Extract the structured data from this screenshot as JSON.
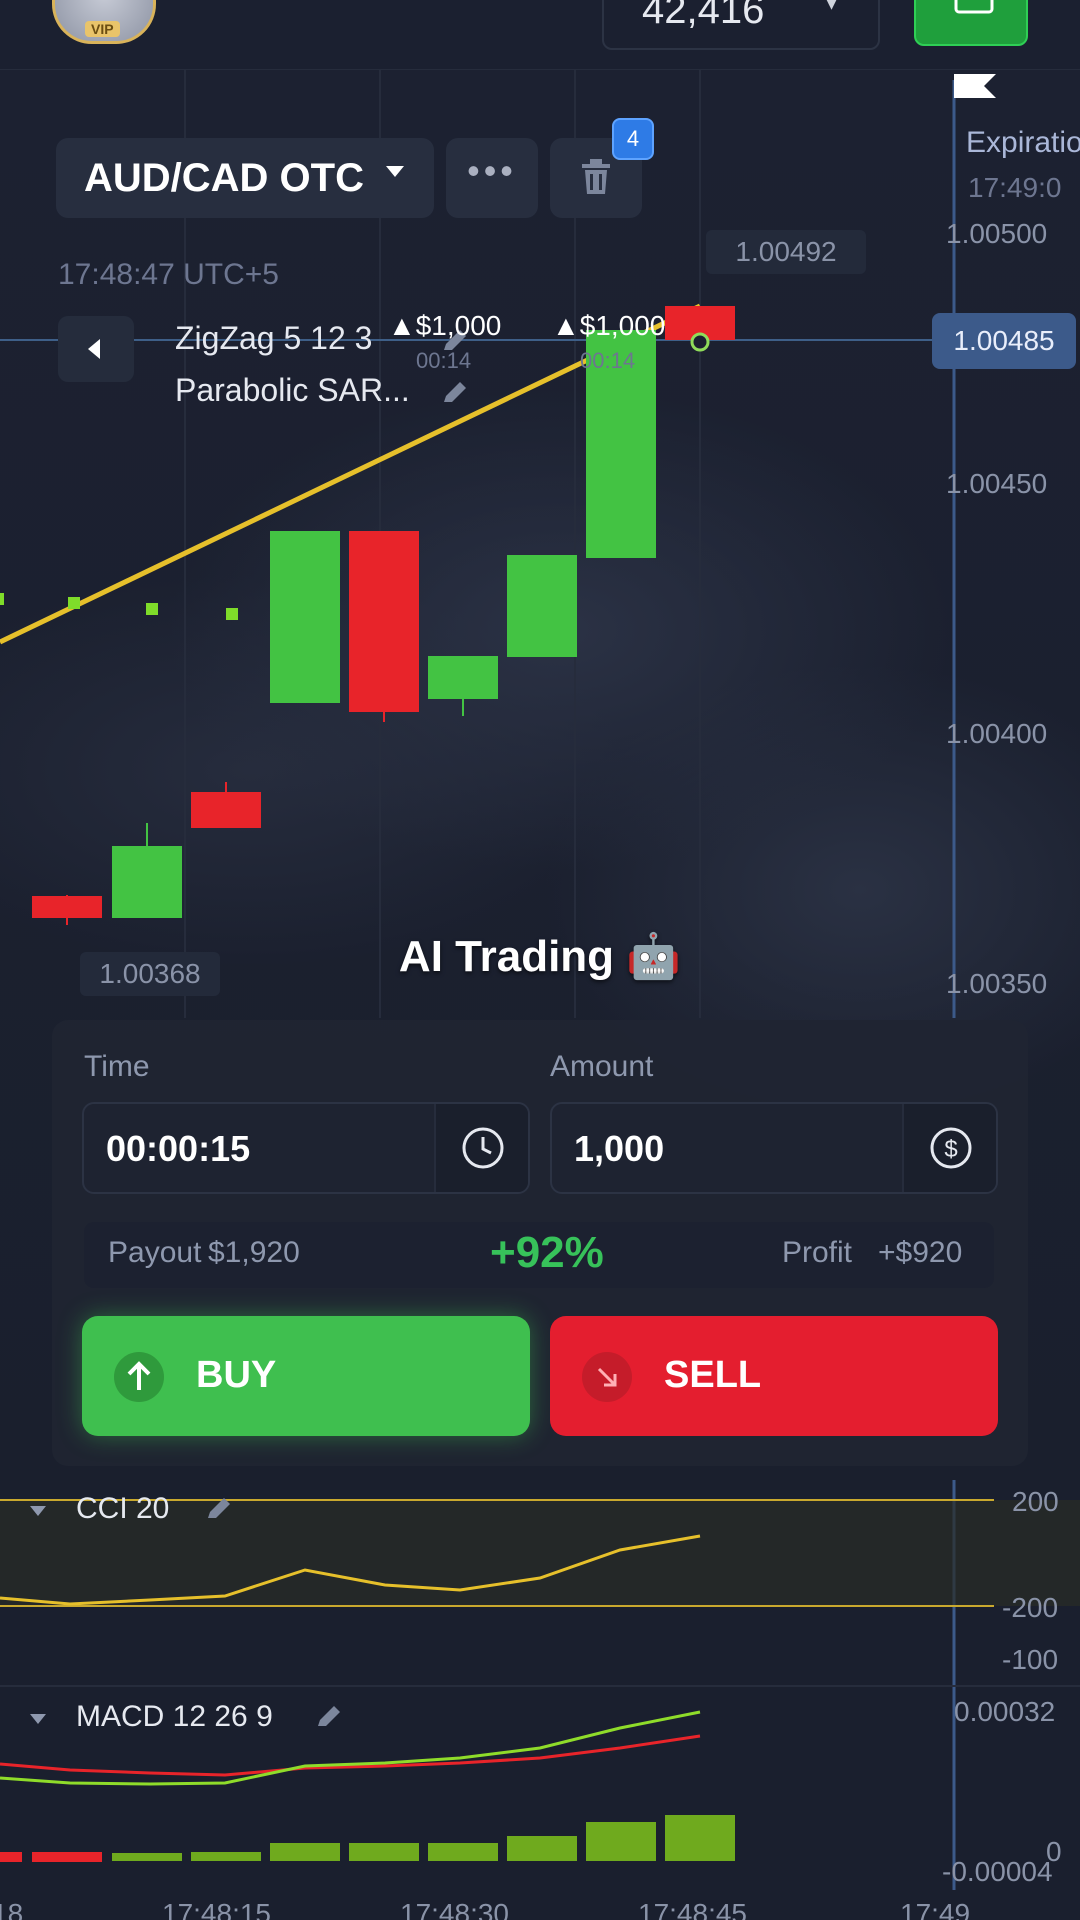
{
  "header": {
    "vip_badge": "VIP",
    "balance": "42,416",
    "wallet_icon": "wallet-icon"
  },
  "chart": {
    "asset": "AUD/CAD OTC",
    "open_trades_count": "4",
    "server_time": "17:48:47 UTC+5",
    "current_price": "1.00485",
    "high_label": "1.00492",
    "low_label": "1.00368",
    "expiration_label": "Expiratio",
    "expiration_time": "17:49:0",
    "price_axis": [
      "1.00500",
      "1.00450",
      "1.00400",
      "1.00350"
    ],
    "indicators": [
      "ZigZag 5 12 3",
      "Parabolic SAR..."
    ],
    "trade_markers": [
      {
        "amount": "$1,000",
        "time": "00:14"
      },
      {
        "amount": "$1,000",
        "time": "00:14"
      }
    ],
    "overlay_caption": "AI Trading 🤖",
    "candle_colors": {
      "up": "#43c343",
      "down": "#e8242a"
    }
  },
  "order_panel": {
    "time_label": "Time",
    "time_value": "00:00:15",
    "amount_label": "Amount",
    "amount_value": "1,000",
    "payout_label": "Payout",
    "payout_value": "$1,920",
    "payout_percent": "+92%",
    "profit_label": "Profit",
    "profit_value": "+$920",
    "buy_label": "BUY",
    "sell_label": "SELL"
  },
  "cci": {
    "label": "CCI 20",
    "axis": [
      "200",
      "-200",
      "-100"
    ]
  },
  "macd": {
    "label": "MACD 12 26 9",
    "axis": [
      "0.00032",
      "0",
      "-0.00004"
    ]
  },
  "time_axis": [
    "18",
    "17:48:15",
    "17:48:30",
    "17:48:45",
    "17:49"
  ]
}
